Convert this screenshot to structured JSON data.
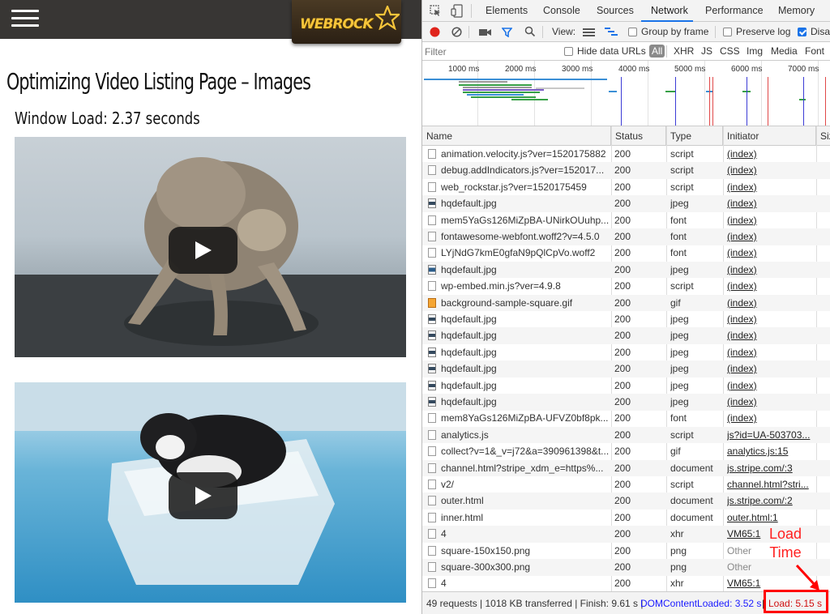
{
  "site": {
    "logo_text": "WEBROCK",
    "title": "Optimizing Video Listing Page – Images",
    "window_load": "Window Load: 2.37 seconds",
    "videos": [
      {
        "name": "cat-on-ice-video"
      },
      {
        "name": "cat-in-box-video"
      }
    ]
  },
  "devtools": {
    "tabs": [
      "Elements",
      "Console",
      "Sources",
      "Network",
      "Performance",
      "Memory"
    ],
    "active_tab": "Network",
    "toolbar": {
      "view_label": "View:",
      "group_by_frame": "Group by frame",
      "preserve_log": "Preserve log",
      "disable_cache": "Disa"
    },
    "filter": {
      "placeholder": "Filter",
      "hide_data_urls": "Hide data URLs",
      "types": [
        "All",
        "XHR",
        "JS",
        "CSS",
        "Img",
        "Media",
        "Font"
      ]
    },
    "timeline_ticks": [
      "1000 ms",
      "2000 ms",
      "3000 ms",
      "4000 ms",
      "5000 ms",
      "6000 ms",
      "7000 ms"
    ],
    "columns": [
      "Name",
      "Status",
      "Type",
      "Initiator",
      "Size"
    ],
    "requests": [
      {
        "name": "animation.velocity.js?ver=1520175882",
        "status": "200",
        "type": "script",
        "initiator": "(index)",
        "icon": "doc"
      },
      {
        "name": "debug.addIndicators.js?ver=152017...",
        "status": "200",
        "type": "script",
        "initiator": "(index)",
        "icon": "doc"
      },
      {
        "name": "web_rockstar.js?ver=1520175459",
        "status": "200",
        "type": "script",
        "initiator": "(index)",
        "icon": "doc"
      },
      {
        "name": "hqdefault.jpg",
        "status": "200",
        "type": "jpeg",
        "initiator": "(index)",
        "icon": "img"
      },
      {
        "name": "mem5YaGs126MiZpBA-UNirkOUuhp...",
        "status": "200",
        "type": "font",
        "initiator": "(index)",
        "icon": "doc"
      },
      {
        "name": "fontawesome-webfont.woff2?v=4.5.0",
        "status": "200",
        "type": "font",
        "initiator": "(index)",
        "icon": "doc"
      },
      {
        "name": "LYjNdG7kmE0gfaN9pQlCpVo.woff2",
        "status": "200",
        "type": "font",
        "initiator": "(index)",
        "icon": "doc"
      },
      {
        "name": "hqdefault.jpg",
        "status": "200",
        "type": "jpeg",
        "initiator": "(index)",
        "icon": "img-blue"
      },
      {
        "name": "wp-embed.min.js?ver=4.9.8",
        "status": "200",
        "type": "script",
        "initiator": "(index)",
        "icon": "doc"
      },
      {
        "name": "background-sample-square.gif",
        "status": "200",
        "type": "gif",
        "initiator": "(index)",
        "icon": "gif"
      },
      {
        "name": "hqdefault.jpg",
        "status": "200",
        "type": "jpeg",
        "initiator": "(index)",
        "icon": "img"
      },
      {
        "name": "hqdefault.jpg",
        "status": "200",
        "type": "jpeg",
        "initiator": "(index)",
        "icon": "img"
      },
      {
        "name": "hqdefault.jpg",
        "status": "200",
        "type": "jpeg",
        "initiator": "(index)",
        "icon": "img"
      },
      {
        "name": "hqdefault.jpg",
        "status": "200",
        "type": "jpeg",
        "initiator": "(index)",
        "icon": "img"
      },
      {
        "name": "hqdefault.jpg",
        "status": "200",
        "type": "jpeg",
        "initiator": "(index)",
        "icon": "img"
      },
      {
        "name": "hqdefault.jpg",
        "status": "200",
        "type": "jpeg",
        "initiator": "(index)",
        "icon": "img"
      },
      {
        "name": "mem8YaGs126MiZpBA-UFVZ0bf8pk...",
        "status": "200",
        "type": "font",
        "initiator": "(index)",
        "icon": "doc"
      },
      {
        "name": "analytics.js",
        "status": "200",
        "type": "script",
        "initiator": "js?id=UA-503703...",
        "icon": "doc"
      },
      {
        "name": "collect?v=1&_v=j72&a=390961398&t...",
        "status": "200",
        "type": "gif",
        "initiator": "analytics.js:15",
        "icon": "doc"
      },
      {
        "name": "channel.html?stripe_xdm_e=https%...",
        "status": "200",
        "type": "document",
        "initiator": "js.stripe.com/:3",
        "icon": "doc"
      },
      {
        "name": "v2/",
        "status": "200",
        "type": "script",
        "initiator": "channel.html?stri...",
        "icon": "doc"
      },
      {
        "name": "outer.html",
        "status": "200",
        "type": "document",
        "initiator": "js.stripe.com/:2",
        "icon": "doc"
      },
      {
        "name": "inner.html",
        "status": "200",
        "type": "document",
        "initiator": "outer.html:1",
        "icon": "doc"
      },
      {
        "name": "4",
        "status": "200",
        "type": "xhr",
        "initiator": "VM65:1",
        "icon": "doc"
      },
      {
        "name": "square-150x150.png",
        "status": "200",
        "type": "png",
        "initiator": "Other",
        "icon": "doc"
      },
      {
        "name": "square-300x300.png",
        "status": "200",
        "type": "png",
        "initiator": "Other",
        "icon": "doc"
      },
      {
        "name": "4",
        "status": "200",
        "type": "xhr",
        "initiator": "VM65:1",
        "icon": "doc"
      }
    ],
    "summary": {
      "requests": "49 requests | 1018 KB transferred | Finish: 9.61 s |",
      "dom_content_loaded": "DOMContentLoaded: 3.52 s",
      "separator": "|",
      "load": "Load: 5.15 s"
    },
    "annotation": {
      "line1": "Load",
      "line2": "Time"
    }
  },
  "colors": {
    "accent": "#1a73e8",
    "annotation": "#ff0000",
    "dom_loaded": "#1a1aff",
    "load": "#d01010"
  }
}
